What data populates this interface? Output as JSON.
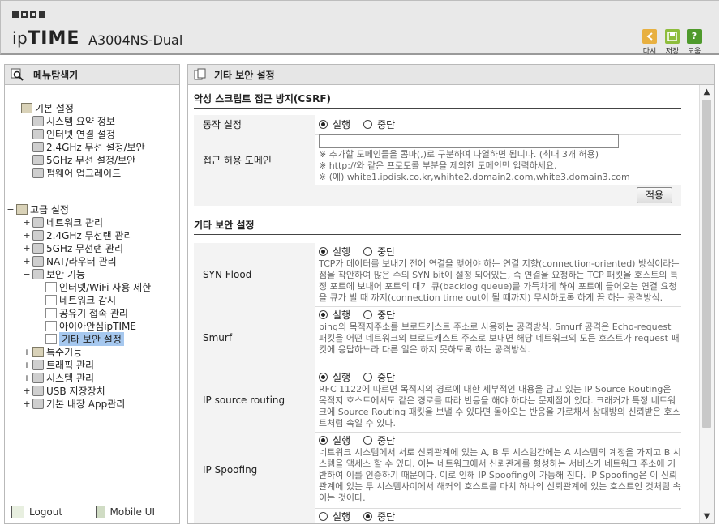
{
  "header": {
    "brand_prefix": "ip",
    "brand_bold": "TIME",
    "model": "A3004NS-Dual",
    "buttons": [
      {
        "label": "다시",
        "icon": "back-icon",
        "color": "#e8b040"
      },
      {
        "label": "저장",
        "icon": "save-icon",
        "color": "#8ebd3c"
      },
      {
        "label": "도움",
        "icon": "help-icon",
        "color": "#4f9a2c",
        "glyph": "?"
      }
    ]
  },
  "left": {
    "title": "메뉴탐색기",
    "tree": [
      {
        "label": "기본 설정",
        "level": 0,
        "icon": "folder-icon",
        "expander": ""
      },
      {
        "label": "시스템 요약 정보",
        "level": 1,
        "icon": "chart-icon"
      },
      {
        "label": "인터넷 연결 설정",
        "level": 1,
        "icon": "monitor-icon"
      },
      {
        "label": "2.4GHz 무선 설정/보안",
        "level": 1,
        "icon": "wireless-icon"
      },
      {
        "label": "5GHz 무선 설정/보안",
        "level": 1,
        "icon": "wireless-icon"
      },
      {
        "label": "펌웨어 업그레이드",
        "level": 1,
        "icon": "upgrade-icon"
      },
      {
        "label": "고급 설정",
        "level": 0,
        "icon": "folder-icon",
        "expander": "−"
      },
      {
        "label": "네트워크 관리",
        "level": 1,
        "icon": "network-icon",
        "expander": "+"
      },
      {
        "label": "2.4GHz 무선랜 관리",
        "level": 1,
        "icon": "wireless-icon",
        "expander": "+"
      },
      {
        "label": "5GHz 무선랜 관리",
        "level": 1,
        "icon": "wireless-icon",
        "expander": "+"
      },
      {
        "label": "NAT/라우터 관리",
        "level": 1,
        "icon": "router-icon",
        "expander": "+"
      },
      {
        "label": "보안 기능",
        "level": 1,
        "icon": "lock-icon",
        "expander": "−"
      },
      {
        "label": "인터넷/WiFi 사용 제한",
        "level": 2,
        "icon": "page-icon"
      },
      {
        "label": "네트워크 감시",
        "level": 2,
        "icon": "page-icon"
      },
      {
        "label": "공유기 접속 관리",
        "level": 2,
        "icon": "page-icon"
      },
      {
        "label": "아이아안심ipTIME",
        "level": 2,
        "icon": "page-icon"
      },
      {
        "label": "기타 보안 설정",
        "level": 2,
        "icon": "page-icon",
        "selected": true
      },
      {
        "label": "특수기능",
        "level": 1,
        "icon": "folder-icon",
        "expander": "+"
      },
      {
        "label": "트래픽 관리",
        "level": 1,
        "icon": "traffic-icon",
        "expander": "+"
      },
      {
        "label": "시스템 관리",
        "level": 1,
        "icon": "system-icon",
        "expander": "+"
      },
      {
        "label": "USB 저장장치",
        "level": 1,
        "icon": "usb-icon",
        "expander": "+"
      },
      {
        "label": "기본 내장 App관리",
        "level": 1,
        "icon": "app-icon",
        "expander": "+"
      }
    ],
    "footer": {
      "logout": "Logout",
      "mobile": "Mobile UI"
    }
  },
  "right": {
    "title": "기타 보안 설정",
    "csrf_section": "악성 스크립트 접근 방지(CSRF)",
    "action_label": "동작 설정",
    "radio_on": "실행",
    "radio_off": "중단",
    "domain_label": "접근 허용 도메인",
    "domain_value": "",
    "domain_help": [
      "※ 추가할 도메인들을 콤마(,)로 구분하여 나열하면 됩니다. (최대 3개 허용)",
      "※ http://와 같은 프로토콜 부분을 제외한 도메인만 입력하세요.",
      "※ (예) white1.ipdisk.co.kr,whihte2.domain2.com,white3.domain3.com"
    ],
    "apply_label": "적용",
    "other_section": "기타 보안 설정",
    "items": [
      {
        "label": "SYN Flood",
        "state": "on",
        "desc": "TCP가 데이터를 보내기 전에 연결을 맺어야 하는 연결 지향(connection-oriented) 방식이라는 점을 착안하여 많은 수의 SYN bit이 설정 되어있는, 즉 연결을 요청하는 TCP 패킷을 호스트의 특정 포트에 보내어 포트의 대기 큐(backlog queue)를 가득차게 하여 포트에 들어오는 연결 요청을 큐가 빌 때 까지(connection time out이 될 때까지) 무시하도록 하게 끔 하는 공격방식."
      },
      {
        "label": "Smurf",
        "state": "on",
        "desc": "ping의 목적지주소를 브로드캐스트 주소로 사용하는 공격방식. Smurf 공격은 Echo-request 패킷을 어떤 네트워크의 브로드캐스트 주소로 보내면 해당 네트워크의 모든 호스트가 request 패킷에 응답하느라 다른 일은 하지 못하도록 하는 공격방식."
      },
      {
        "label": "IP source routing",
        "state": "on",
        "desc": "RFC 1122에 따르면 목적지의 경로에 대한 세부적인 내용을 담고 있는 IP Source Routing은 목적지 호스트에서도 같은 경로를 따라 반응을 해야 하다는 문제점이 있다. 크래커가 특정 네트워크에 Source Routing 패킷을 보낼 수 있다면 돌아오는 반응을 가로채서 상대방의 신뢰받은 호스트처럼 속일 수 있다."
      },
      {
        "label": "IP Spoofing",
        "state": "on",
        "desc": "네트워크 시스템에서 서로 신뢰관계에 있는 A, B 두 시스템간에는 A 시스템의 계정을 가지고 B 시스템을 액세스 할 수 있다. 이는 네트워크에서 신뢰관계를 형성하는 서비스가 네트워크 주소에 기반하여 이를 인증하기 때문이다. 이로 인해 IP Spoofing이 가능해 진다. IP Spoofing은 이 신뢰관계에 있는 두 시스템사이에서 해커의 호스트를 마치 하나의 신뢰관계에 있는 호스트인 것처럼 속이는 것이다."
      },
      {
        "label": "",
        "state": "off",
        "desc": ""
      }
    ]
  }
}
